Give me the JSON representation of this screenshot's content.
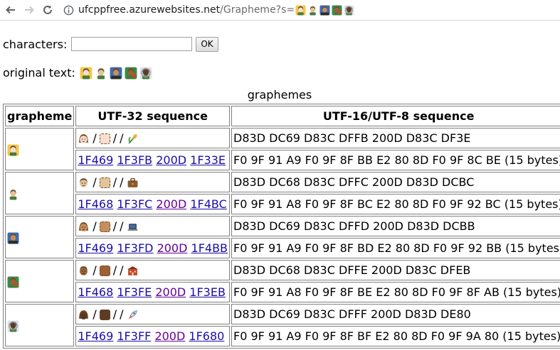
{
  "browser": {
    "back_icon": "arrow-left-icon",
    "forward_icon": "arrow-right-icon",
    "reload_icon": "reload-icon",
    "host": "ufcppfree.azurewebsites.net",
    "path": "/Grapheme?s="
  },
  "form": {
    "label": "characters:",
    "input_value": "",
    "ok_label": "OK"
  },
  "original": {
    "label": "original text:"
  },
  "table": {
    "caption": "graphemes",
    "headers": [
      "grapheme",
      "UTF-32 sequence",
      "UTF-16/UTF-8 sequence"
    ],
    "rows": [
      {
        "person": "woman",
        "tone": "light",
        "object": "ear-of-rice-icon",
        "codepoints": [
          "1F469",
          "1F3FB",
          "200D",
          "1F33E"
        ],
        "utf16": "D83D DC69 D83C DFFB 200D D83C DF3E",
        "utf8": "F0 9F 91 A9 F0 9F 8F BB E2 80 8D F0 9F 8C BE (15 bytes)"
      },
      {
        "person": "man",
        "tone": "medium-light",
        "object": "briefcase-icon",
        "codepoints": [
          "1F468",
          "1F3FC",
          "200D",
          "1F4BC"
        ],
        "utf16": "D83D DC68 D83C DFFC 200D D83D DCBC",
        "utf8": "F0 9F 91 A8 F0 9F 8F BC E2 80 8D F0 9F 92 BC (15 bytes)"
      },
      {
        "person": "woman",
        "tone": "medium",
        "object": "laptop-icon",
        "codepoints": [
          "1F469",
          "1F3FD",
          "200D",
          "1F4BB"
        ],
        "utf16": "D83D DC69 D83C DFFD 200D D83D DCBB",
        "utf8": "F0 9F 91 A9 F0 9F 8F BD E2 80 8D F0 9F 92 BB (15 bytes)"
      },
      {
        "person": "man",
        "tone": "medium-dark",
        "object": "school-icon",
        "codepoints": [
          "1F468",
          "1F3FE",
          "200D",
          "1F3EB"
        ],
        "utf16": "D83D DC68 D83C DFFE 200D D83C DFEB",
        "utf8": "F0 9F 91 A8 F0 9F 8F BE E2 80 8D F0 9F 8F AB (15 bytes)"
      },
      {
        "person": "woman",
        "tone": "dark",
        "object": "rocket-icon",
        "codepoints": [
          "1F469",
          "1F3FF",
          "200D",
          "1F680"
        ],
        "utf16": "D83D DC69 D83C DFFF 200D D83D DE80",
        "utf8": "F0 9F 91 A9 F0 9F 8F BF E2 80 8D F0 9F 9A 80 (15 bytes)"
      }
    ],
    "separator": "/"
  },
  "colors": {
    "link": "#1a0dab",
    "visited_link": "#660099",
    "border": "#808080",
    "tones": {
      "light": "#f7dece",
      "medium-light": "#e2c49a",
      "medium": "#c68e5f",
      "medium-dark": "#9c6134",
      "dark": "#5e3b25"
    }
  }
}
